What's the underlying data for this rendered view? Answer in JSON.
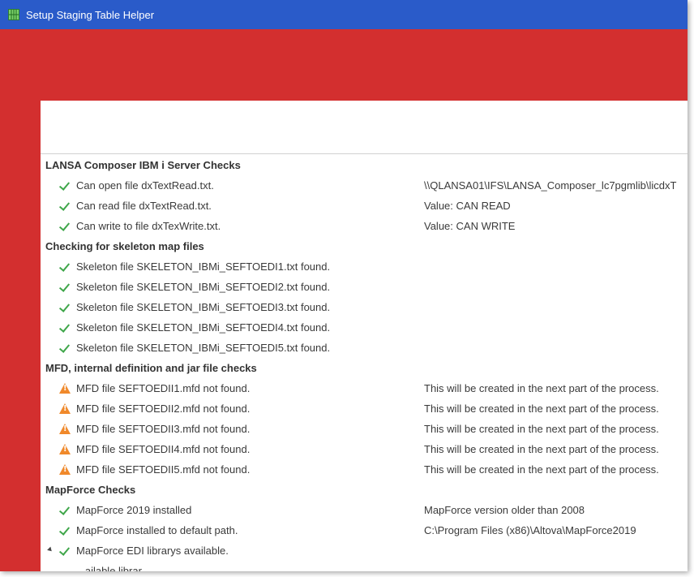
{
  "window": {
    "title": "Setup Staging Table Helper",
    "icon": "grid-app-icon"
  },
  "colors": {
    "titlebar": "#2a5bc9",
    "background": "#d32f2f",
    "check": "#3fa64a",
    "warning": "#f0892b"
  },
  "sections": [
    {
      "title": "LANSA Composer IBM i Server Checks",
      "items": [
        {
          "status": "ok",
          "label": "Can open file dxTextRead.txt.",
          "value": "\\\\QLANSA01\\IFS\\LANSA_Composer_lc7pgmlib\\licdxT"
        },
        {
          "status": "ok",
          "label": "Can read file dxTextRead.txt.",
          "value": "Value:  CAN READ"
        },
        {
          "status": "ok",
          "label": "Can write to file dxTexWrite.txt.",
          "value": "Value:  CAN WRITE"
        }
      ]
    },
    {
      "title": "Checking for skeleton map files",
      "items": [
        {
          "status": "ok",
          "label": "Skeleton file SKELETON_IBMi_SEFTOEDI1.txt found.",
          "value": ""
        },
        {
          "status": "ok",
          "label": "Skeleton file SKELETON_IBMi_SEFTOEDI2.txt found.",
          "value": ""
        },
        {
          "status": "ok",
          "label": "Skeleton file SKELETON_IBMi_SEFTOEDI3.txt found.",
          "value": ""
        },
        {
          "status": "ok",
          "label": "Skeleton file SKELETON_IBMi_SEFTOEDI4.txt found.",
          "value": ""
        },
        {
          "status": "ok",
          "label": "Skeleton file SKELETON_IBMi_SEFTOEDI5.txt found.",
          "value": ""
        }
      ]
    },
    {
      "title": "MFD, internal definition and jar file checks",
      "items": [
        {
          "status": "warning",
          "label": "MFD file SEFTOEDII1.mfd not found.",
          "value": "This will be created in the next part of the process."
        },
        {
          "status": "warning",
          "label": "MFD file SEFTOEDII2.mfd not found.",
          "value": "This will be created in the next part of the process."
        },
        {
          "status": "warning",
          "label": "MFD file SEFTOEDII3.mfd not found.",
          "value": "This will be created in the next part of the process."
        },
        {
          "status": "warning",
          "label": "MFD file SEFTOEDII4.mfd not found.",
          "value": "This will be created in the next part of the process."
        },
        {
          "status": "warning",
          "label": "MFD file SEFTOEDII5.mfd not found.",
          "value": "This will be created in the next part of the process."
        }
      ]
    },
    {
      "title": "MapForce Checks",
      "items": [
        {
          "status": "ok",
          "label": "MapForce 2019 installed",
          "value": "MapForce version older than 2008"
        },
        {
          "status": "ok",
          "label": "MapForce installed to default path.",
          "value": "C:\\Program Files (x86)\\Altova\\MapForce2019"
        },
        {
          "status": "ok",
          "label": "MapForce EDI librarys available.",
          "value": "",
          "expanded": true
        },
        {
          "status": "none",
          "label": "...ailable librar...",
          "value": ""
        }
      ]
    }
  ]
}
